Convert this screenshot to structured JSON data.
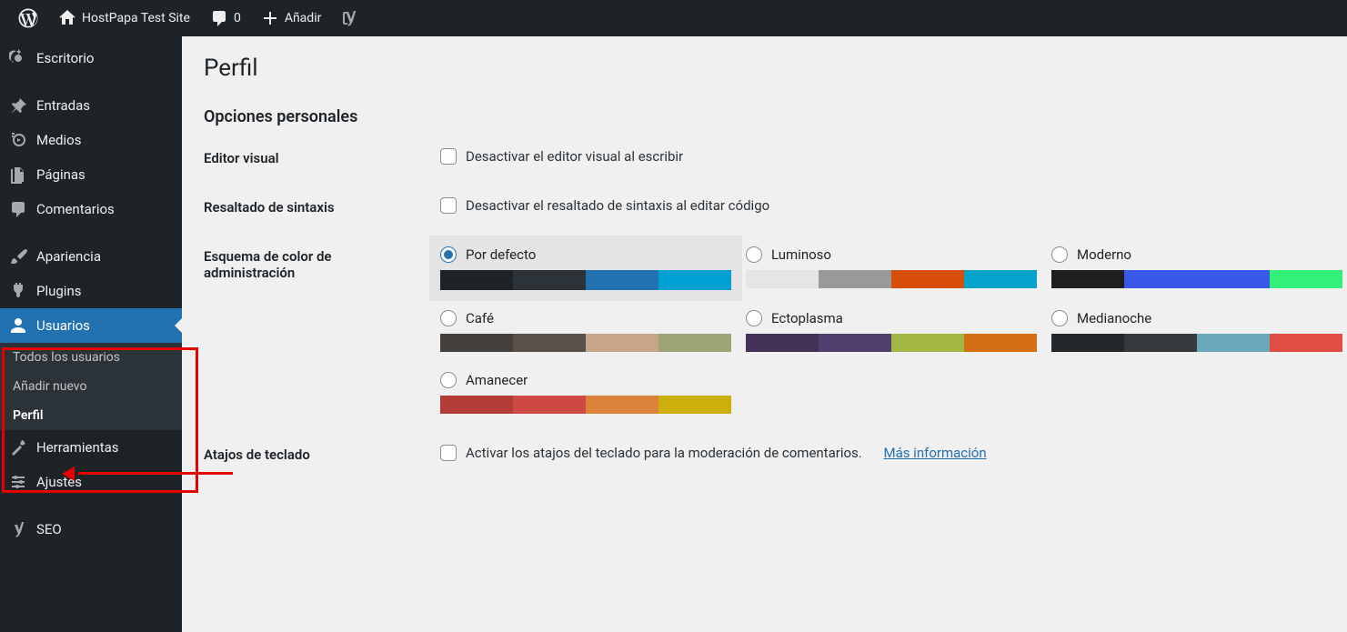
{
  "adminbar": {
    "site_name": "HostPapa Test Site",
    "comments_count": "0",
    "add_label": "Añadir"
  },
  "sidebar": {
    "dashboard": "Escritorio",
    "posts": "Entradas",
    "media": "Medios",
    "pages": "Páginas",
    "comments": "Comentarios",
    "appearance": "Apariencia",
    "plugins": "Plugins",
    "users": "Usuarios",
    "tools": "Herramientas",
    "settings": "Ajustes",
    "seo": "SEO",
    "submenu": {
      "all_users": "Todos los usuarios",
      "add_new": "Añadir nuevo",
      "profile": "Perfil"
    }
  },
  "page": {
    "title": "Perfil",
    "section_personal": "Opciones personales",
    "rows": {
      "visual_editor_label": "Editor visual",
      "visual_editor_check": "Desactivar el editor visual al escribir",
      "syntax_label": "Resaltado de sintaxis",
      "syntax_check": "Desactivar el resaltado de sintaxis al editar código",
      "color_scheme_label": "Esquema de color de administración",
      "shortcuts_label": "Atajos de teclado",
      "shortcuts_check": "Activar los atajos del teclado para la moderación de comentarios.",
      "shortcuts_link": "Más información"
    },
    "schemes": {
      "default": "Por defecto",
      "light": "Luminoso",
      "modern": "Moderno",
      "coffee": "Café",
      "ectoplasm": "Ectoplasma",
      "midnight": "Medianoche",
      "sunrise": "Amanecer"
    }
  }
}
